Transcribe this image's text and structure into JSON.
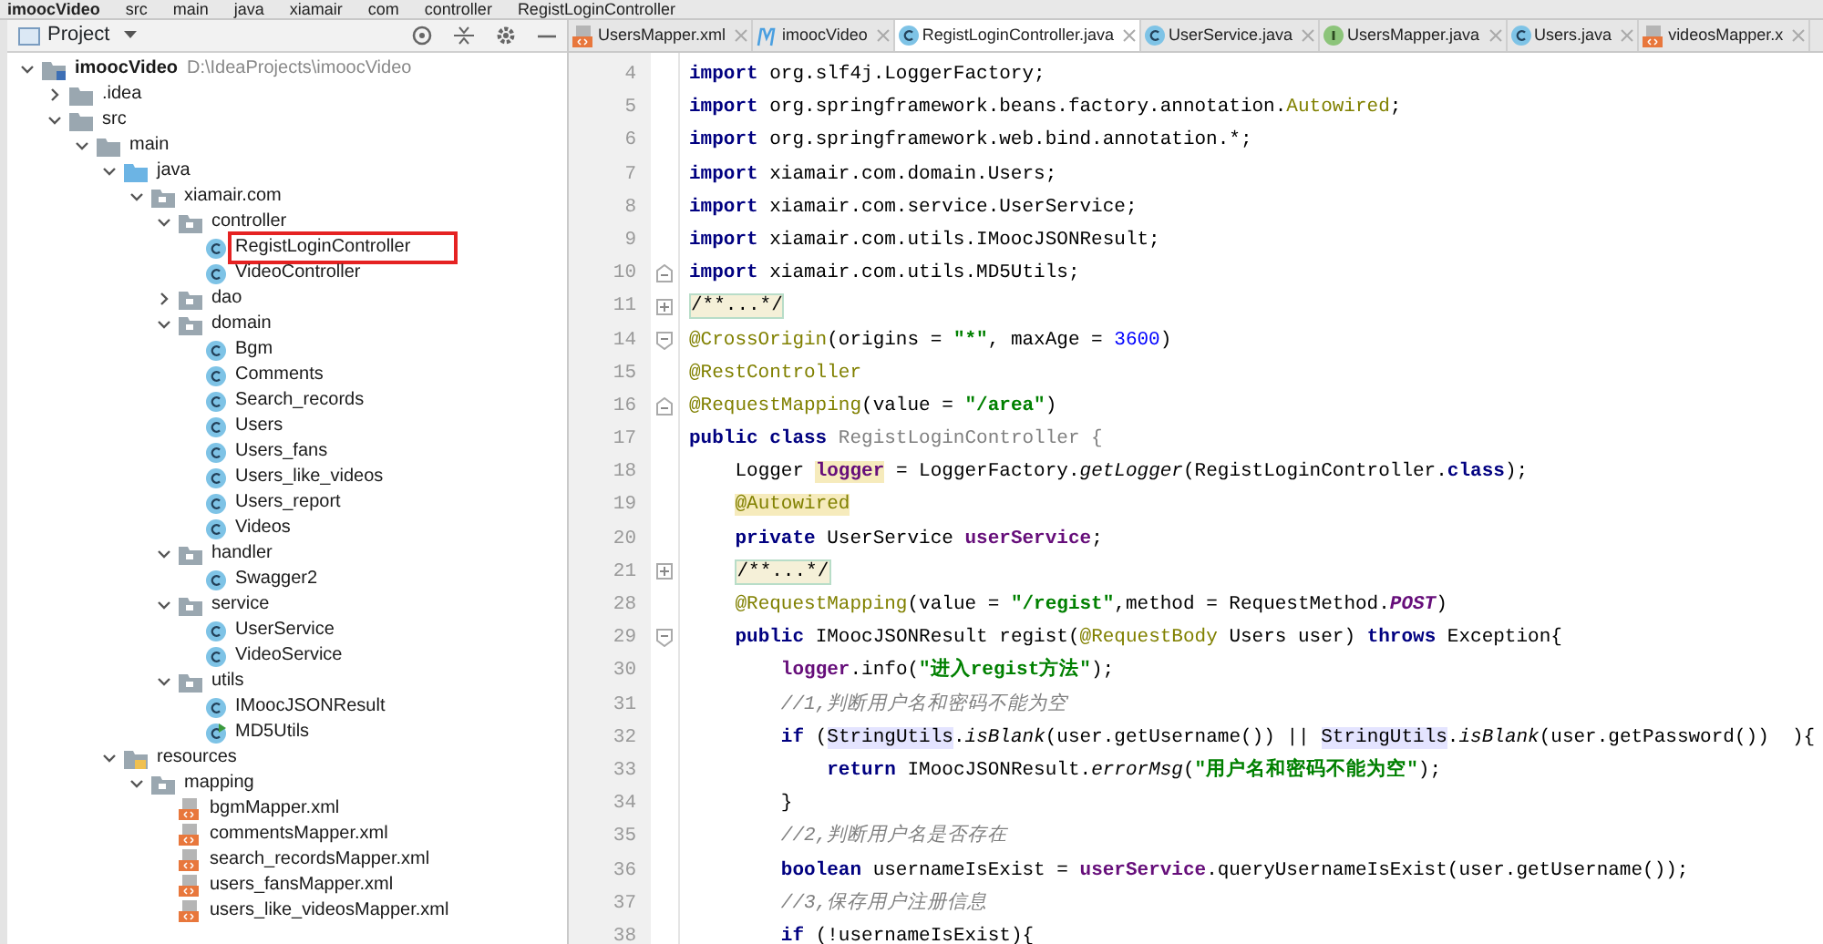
{
  "breadcrumb": [
    "imoocVideo",
    "src",
    "main",
    "java",
    "xiamair",
    "com",
    "controller",
    "RegistLoginController"
  ],
  "project_panel": {
    "title": "Project",
    "tree": [
      {
        "label": "imoocVideo",
        "kind": "module",
        "path": "D:\\IdeaProjects\\imoocVideo",
        "expanded": true,
        "children": [
          {
            "label": ".idea",
            "kind": "folder",
            "expanded": false
          },
          {
            "label": "src",
            "kind": "folder",
            "expanded": true,
            "children": [
              {
                "label": "main",
                "kind": "folder",
                "expanded": true,
                "children": [
                  {
                    "label": "java",
                    "kind": "source",
                    "expanded": true,
                    "children": [
                      {
                        "label": "xiamair.com",
                        "kind": "package",
                        "expanded": true,
                        "children": [
                          {
                            "label": "controller",
                            "kind": "package",
                            "expanded": true,
                            "children": [
                              {
                                "label": "RegistLoginController",
                                "kind": "class",
                                "outlined": true
                              },
                              {
                                "label": "VideoController",
                                "kind": "class",
                                "outlined": false
                              }
                            ]
                          },
                          {
                            "label": "dao",
                            "kind": "package",
                            "expanded": false
                          },
                          {
                            "label": "domain",
                            "kind": "package",
                            "expanded": true,
                            "children": [
                              {
                                "label": "Bgm",
                                "kind": "class",
                                "outlined": false
                              },
                              {
                                "label": "Comments",
                                "kind": "class",
                                "outlined": false
                              },
                              {
                                "label": "Search_records",
                                "kind": "class",
                                "outlined": false
                              },
                              {
                                "label": "Users",
                                "kind": "class",
                                "outlined": false
                              },
                              {
                                "label": "Users_fans",
                                "kind": "class",
                                "outlined": false
                              },
                              {
                                "label": "Users_like_videos",
                                "kind": "class",
                                "outlined": false
                              },
                              {
                                "label": "Users_report",
                                "kind": "class",
                                "outlined": false
                              },
                              {
                                "label": "Videos",
                                "kind": "class",
                                "outlined": false
                              }
                            ]
                          },
                          {
                            "label": "handler",
                            "kind": "package",
                            "expanded": true,
                            "children": [
                              {
                                "label": "Swagger2",
                                "kind": "class",
                                "outlined": false
                              }
                            ]
                          },
                          {
                            "label": "service",
                            "kind": "package",
                            "expanded": true,
                            "children": [
                              {
                                "label": "UserService",
                                "kind": "class",
                                "outlined": false
                              },
                              {
                                "label": "VideoService",
                                "kind": "class",
                                "outlined": false
                              }
                            ]
                          },
                          {
                            "label": "utils",
                            "kind": "package",
                            "expanded": true,
                            "children": [
                              {
                                "label": "IMoocJSONResult",
                                "kind": "class",
                                "outlined": false
                              },
                              {
                                "label": "MD5Utils",
                                "kind": "runnable",
                                "outlined": false
                              }
                            ]
                          }
                        ]
                      }
                    ]
                  },
                  {
                    "label": "resources",
                    "kind": "resources",
                    "expanded": true,
                    "children": [
                      {
                        "label": "mapping",
                        "kind": "package",
                        "expanded": true,
                        "children": [
                          {
                            "label": "bgmMapper.xml",
                            "kind": "xml",
                            "outlined": false
                          },
                          {
                            "label": "commentsMapper.xml",
                            "kind": "xml",
                            "outlined": false
                          },
                          {
                            "label": "search_recordsMapper.xml",
                            "kind": "xml",
                            "outlined": false
                          },
                          {
                            "label": "users_fansMapper.xml",
                            "kind": "xml",
                            "outlined": false
                          },
                          {
                            "label": "users_like_videosMapper.xml",
                            "kind": "xml",
                            "outlined": false
                          }
                        ]
                      }
                    ]
                  }
                ]
              }
            ]
          }
        ]
      }
    ]
  },
  "tabs": [
    {
      "label": "UsersMapper.xml",
      "kind": "xml",
      "selected": false
    },
    {
      "label": "imoocVideo",
      "kind": "maven",
      "selected": false
    },
    {
      "label": "RegistLoginController.java",
      "kind": "class",
      "selected": true
    },
    {
      "label": "UserService.java",
      "kind": "class",
      "selected": false
    },
    {
      "label": "UsersMapper.java",
      "kind": "interface",
      "selected": false
    },
    {
      "label": "Users.java",
      "kind": "class",
      "selected": false
    },
    {
      "label": "videosMapper.x",
      "kind": "xml",
      "selected": false
    }
  ],
  "editor": {
    "lines": [
      {
        "number": "4",
        "kind": "plain",
        "tokens": [
          {
            "kind": "kw",
            "text": "import"
          },
          {
            "kind": "plain",
            "text": " org.slf4j.LoggerFactory;"
          }
        ]
      },
      {
        "number": "5",
        "kind": "plain",
        "tokens": [
          {
            "kind": "kw",
            "text": "import"
          },
          {
            "kind": "plain",
            "text": " org.springframework.beans.factory.annotation."
          },
          {
            "kind": "ann",
            "text": "Autowired"
          },
          {
            "kind": "plain",
            "text": ";"
          }
        ]
      },
      {
        "number": "6",
        "kind": "plain",
        "tokens": [
          {
            "kind": "kw",
            "text": "import"
          },
          {
            "kind": "plain",
            "text": " org.springframework.web.bind.annotation.*;"
          }
        ]
      },
      {
        "number": "7",
        "kind": "plain",
        "tokens": [
          {
            "kind": "kw",
            "text": "import"
          },
          {
            "kind": "plain",
            "text": " xiamair.com.domain.Users;"
          }
        ]
      },
      {
        "number": "8",
        "kind": "plain",
        "tokens": [
          {
            "kind": "kw",
            "text": "import"
          },
          {
            "kind": "plain",
            "text": " xiamair.com.service.UserService;"
          }
        ]
      },
      {
        "number": "9",
        "kind": "plain",
        "tokens": [
          {
            "kind": "kw",
            "text": "import"
          },
          {
            "kind": "plain",
            "text": " xiamair.com.utils.IMoocJSONResult;"
          }
        ]
      },
      {
        "number": "10",
        "kind": "fold_end",
        "tokens": [
          {
            "kind": "kw",
            "text": "import"
          },
          {
            "kind": "plain",
            "text": " xiamair.com.utils.MD5Utils;"
          }
        ]
      },
      {
        "number": "11",
        "kind": "folded",
        "tokens": [
          {
            "kind": "folded",
            "text": "/**...*/"
          }
        ]
      },
      {
        "number": "14",
        "kind": "fold_start",
        "tokens": [
          {
            "kind": "ann",
            "text": "@CrossOrigin"
          },
          {
            "kind": "plain",
            "text": "(origins = "
          },
          {
            "kind": "str",
            "text": "\"*\""
          },
          {
            "kind": "plain",
            "text": ", maxAge = "
          },
          {
            "kind": "num",
            "text": "3600"
          },
          {
            "kind": "plain",
            "text": ")"
          }
        ]
      },
      {
        "number": "15",
        "kind": "plain",
        "tokens": [
          {
            "kind": "ann",
            "text": "@RestController"
          }
        ]
      },
      {
        "number": "16",
        "kind": "fold_end",
        "tokens": [
          {
            "kind": "ann",
            "text": "@RequestMapping"
          },
          {
            "kind": "plain",
            "text": "(value = "
          },
          {
            "kind": "str",
            "text": "\"/area\""
          },
          {
            "kind": "plain",
            "text": ")"
          }
        ]
      },
      {
        "number": "17",
        "kind": "plain",
        "tokens": [
          {
            "kind": "kw",
            "text": "public class"
          },
          {
            "kind": "unused",
            "text": " RegistLoginController {"
          }
        ]
      },
      {
        "number": "18",
        "kind": "plain",
        "tokens": [
          {
            "kind": "plain",
            "text": "    Logger "
          },
          {
            "kind": "fieldhl",
            "text": "logger"
          },
          {
            "kind": "plain",
            "text": " = LoggerFactory."
          },
          {
            "kind": "italic",
            "text": "getLogger"
          },
          {
            "kind": "plain",
            "text": "(RegistLoginController."
          },
          {
            "kind": "kw",
            "text": "class"
          },
          {
            "kind": "plain",
            "text": ");"
          }
        ]
      },
      {
        "number": "19",
        "kind": "plain",
        "tokens": [
          {
            "kind": "annhl",
            "text": "    @Autowired"
          }
        ]
      },
      {
        "number": "20",
        "kind": "plain",
        "tokens": [
          {
            "kind": "kw",
            "text": "    private"
          },
          {
            "kind": "plain",
            "text": " UserService "
          },
          {
            "kind": "field",
            "text": "userService"
          },
          {
            "kind": "plain",
            "text": ";"
          }
        ]
      },
      {
        "number": "21",
        "kind": "folded",
        "tokens": [
          {
            "kind": "folded",
            "text": "    /**...*/"
          }
        ]
      },
      {
        "number": "28",
        "kind": "plain",
        "tokens": [
          {
            "kind": "ann",
            "text": "    @RequestMapping"
          },
          {
            "kind": "plain",
            "text": "(value = "
          },
          {
            "kind": "str",
            "text": "\"/regist\""
          },
          {
            "kind": "plain",
            "text": ",method = RequestMethod."
          },
          {
            "kind": "constant",
            "text": "POST"
          },
          {
            "kind": "plain",
            "text": ")"
          }
        ]
      },
      {
        "number": "29",
        "kind": "fold_start",
        "tokens": [
          {
            "kind": "kw",
            "text": "    public"
          },
          {
            "kind": "plain",
            "text": " IMoocJSONResult regist("
          },
          {
            "kind": "ann",
            "text": "@RequestBody"
          },
          {
            "kind": "plain",
            "text": " Users user) "
          },
          {
            "kind": "kw",
            "text": "throws"
          },
          {
            "kind": "plain",
            "text": " Exception{"
          }
        ]
      },
      {
        "number": "30",
        "kind": "plain",
        "tokens": [
          {
            "kind": "field",
            "text": "        logger"
          },
          {
            "kind": "plain",
            "text": ".info("
          },
          {
            "kind": "str",
            "text": "\"进入regist方法\""
          },
          {
            "kind": "plain",
            "text": ");"
          }
        ]
      },
      {
        "number": "31",
        "kind": "plain",
        "tokens": [
          {
            "kind": "comment",
            "text": "        //1,判断用户名和密码不能为空"
          }
        ]
      },
      {
        "number": "32",
        "kind": "plain",
        "tokens": [
          {
            "kind": "kw",
            "text": "        if"
          },
          {
            "kind": "plain",
            "text": " ("
          },
          {
            "kind": "hl",
            "text": "StringUtils"
          },
          {
            "kind": "plain",
            "text": "."
          },
          {
            "kind": "italic",
            "text": "isBlank"
          },
          {
            "kind": "plain",
            "text": "(user.getUsername()) || "
          },
          {
            "kind": "hl",
            "text": "StringUtils"
          },
          {
            "kind": "plain",
            "text": "."
          },
          {
            "kind": "italic",
            "text": "isBlank"
          },
          {
            "kind": "plain",
            "text": "(user.getPassword())  ){"
          }
        ]
      },
      {
        "number": "33",
        "kind": "plain",
        "tokens": [
          {
            "kind": "kw",
            "text": "            return"
          },
          {
            "kind": "plain",
            "text": " IMoocJSONResult."
          },
          {
            "kind": "italic",
            "text": "errorMsg"
          },
          {
            "kind": "plain",
            "text": "("
          },
          {
            "kind": "str",
            "text": "\"用户名和密码不能为空\""
          },
          {
            "kind": "plain",
            "text": ");"
          }
        ]
      },
      {
        "number": "34",
        "kind": "plain",
        "tokens": [
          {
            "kind": "plain",
            "text": "        }"
          }
        ]
      },
      {
        "number": "35",
        "kind": "plain",
        "tokens": [
          {
            "kind": "comment",
            "text": "        //2,判断用户名是否存在"
          }
        ]
      },
      {
        "number": "36",
        "kind": "plain",
        "tokens": [
          {
            "kind": "kw",
            "text": "        boolean"
          },
          {
            "kind": "plain",
            "text": " usernameIsExist = "
          },
          {
            "kind": "field",
            "text": "userService"
          },
          {
            "kind": "plain",
            "text": ".queryUsernameIsExist(user.getUsername());"
          }
        ]
      },
      {
        "number": "37",
        "kind": "plain",
        "tokens": [
          {
            "kind": "comment",
            "text": "        //3,保存用户注册信息"
          }
        ]
      },
      {
        "number": "38",
        "kind": "plain",
        "tokens": [
          {
            "kind": "kw",
            "text": "        if"
          },
          {
            "kind": "plain",
            "text": " (!usernameIsExist){"
          }
        ]
      }
    ]
  }
}
